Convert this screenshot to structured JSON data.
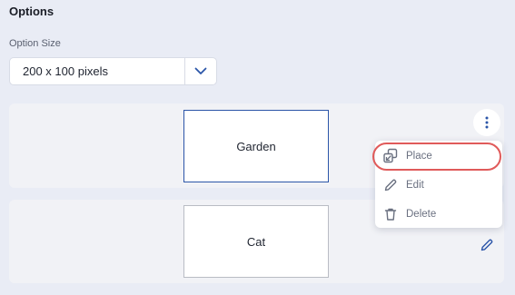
{
  "section": {
    "title": "Options"
  },
  "option_size": {
    "label": "Option Size",
    "selected": "200 x 100 pixels"
  },
  "options": [
    {
      "label": "Garden",
      "selected": true
    },
    {
      "label": "Cat",
      "selected": false
    }
  ],
  "context_menu": {
    "items": [
      {
        "label": "Place",
        "icon": "place-icon",
        "highlighted": true
      },
      {
        "label": "Edit",
        "icon": "pencil-icon"
      },
      {
        "label": "Delete",
        "icon": "trash-icon"
      }
    ]
  },
  "colors": {
    "accent": "#2b55a8",
    "highlight": "#e05a5a",
    "background": "#e9ecf5"
  }
}
